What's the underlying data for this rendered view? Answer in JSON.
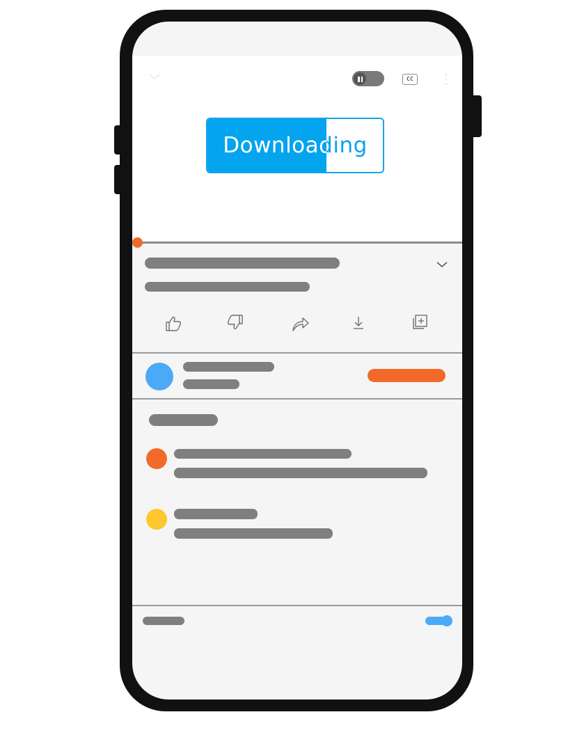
{
  "download_button": {
    "label": "Downloading",
    "progress_percent": 68
  },
  "player": {
    "captions_icon_label": "CC",
    "playback_progress_percent": 0
  },
  "colors": {
    "accent_blue": "#04a4ee",
    "progress_orange": "#f26a2a",
    "subscribe_orange": "#f26a2a",
    "avatar_blue": "#4aaaf7",
    "commenter_orange": "#f26a2a",
    "commenter_yellow": "#fdc72e",
    "placeholder_gray": "#7f7f7f"
  },
  "actions": [
    "thumbs-up-icon",
    "thumbs-down-icon",
    "share-icon",
    "download-icon",
    "add-to-playlist-icon"
  ]
}
